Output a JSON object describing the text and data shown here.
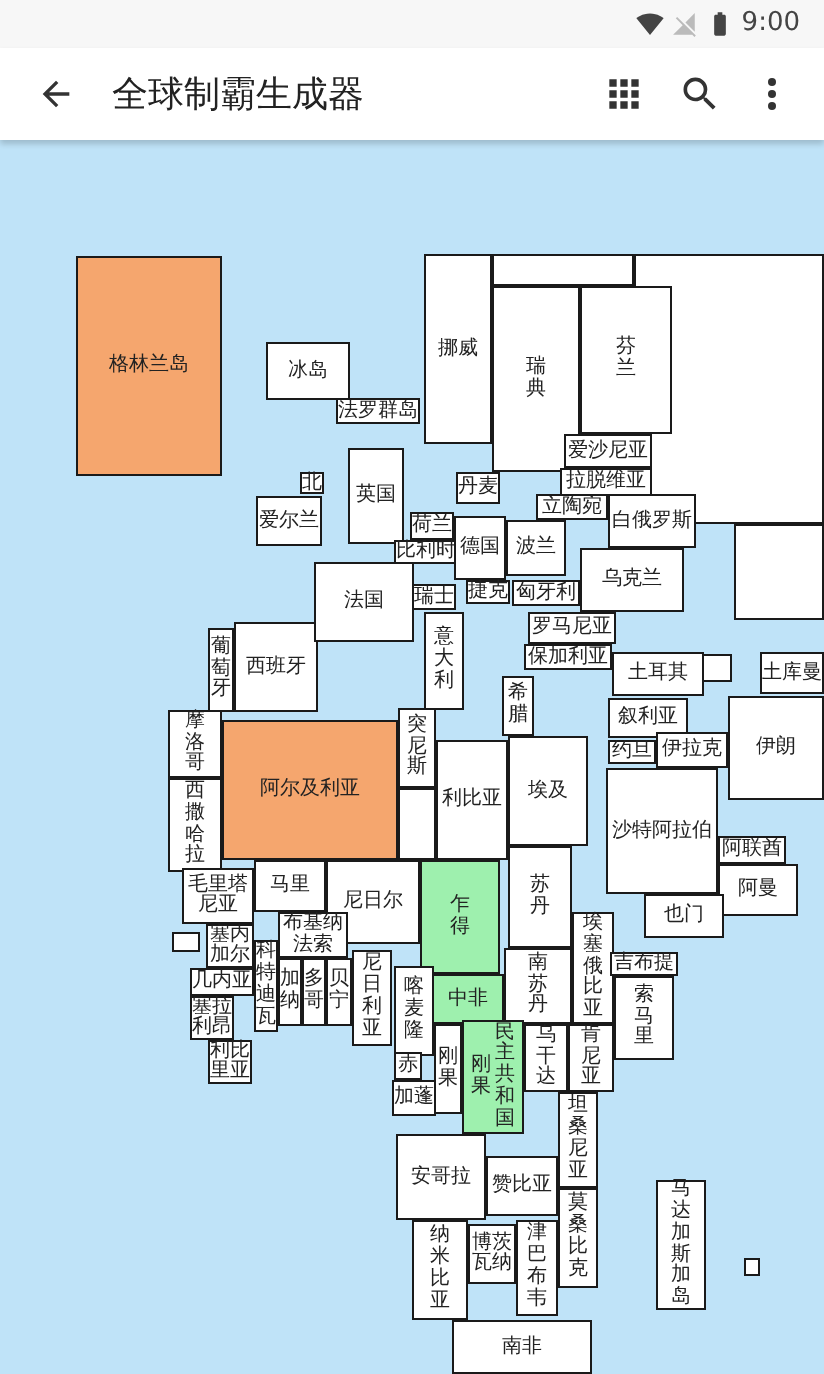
{
  "status_bar": {
    "time": "9:00"
  },
  "app_bar": {
    "title": "全球制霸生成器"
  },
  "countries": [
    {
      "name": "格林兰岛",
      "color": "#f5a66e"
    },
    {
      "name": "冰岛",
      "color": "#ffffff"
    },
    {
      "name": "法罗群岛",
      "color": "#ffffff"
    },
    {
      "name": "挪威",
      "color": "#ffffff"
    },
    {
      "name": "瑞典",
      "color": "#ffffff"
    },
    {
      "name": "芬兰",
      "color": "#ffffff"
    },
    {
      "name": "爱沙尼亚",
      "color": "#ffffff"
    },
    {
      "name": "丹麦",
      "color": "#ffffff"
    },
    {
      "name": "拉脱维亚",
      "color": "#ffffff"
    },
    {
      "name": "英国",
      "color": "#ffffff"
    },
    {
      "name": "北",
      "color": "#ffffff"
    },
    {
      "name": "爱尔兰",
      "color": "#ffffff"
    },
    {
      "name": "荷兰",
      "color": "#ffffff"
    },
    {
      "name": "比利时",
      "color": "#ffffff"
    },
    {
      "name": "立陶宛",
      "color": "#ffffff"
    },
    {
      "name": "白俄罗斯",
      "color": "#ffffff"
    },
    {
      "name": "德国",
      "color": "#ffffff"
    },
    {
      "name": "波兰",
      "color": "#ffffff"
    },
    {
      "name": "葡萄牙",
      "color": "#ffffff"
    },
    {
      "name": "西班牙",
      "color": "#ffffff"
    },
    {
      "name": "法国",
      "color": "#ffffff"
    },
    {
      "name": "瑞士",
      "color": "#ffffff"
    },
    {
      "name": "捷克",
      "color": "#ffffff"
    },
    {
      "name": "匈牙利",
      "color": "#ffffff"
    },
    {
      "name": "乌克兰",
      "color": "#ffffff"
    },
    {
      "name": "意大利",
      "color": "#ffffff"
    },
    {
      "name": "罗马尼亚",
      "color": "#ffffff"
    },
    {
      "name": "保加利亚",
      "color": "#ffffff"
    },
    {
      "name": "希腊",
      "color": "#ffffff"
    },
    {
      "name": "土耳其",
      "color": "#ffffff"
    },
    {
      "name": "叙利亚",
      "color": "#ffffff"
    },
    {
      "name": "伊朗",
      "color": "#ffffff"
    },
    {
      "name": "土库曼",
      "color": "#ffffff"
    },
    {
      "name": "摩洛哥",
      "color": "#ffffff"
    },
    {
      "name": "阿尔及利亚",
      "color": "#f5a66e"
    },
    {
      "name": "突尼斯",
      "color": "#ffffff"
    },
    {
      "name": "利比亚",
      "color": "#ffffff"
    },
    {
      "name": "埃及",
      "color": "#ffffff"
    },
    {
      "name": "约旦",
      "color": "#ffffff"
    },
    {
      "name": "伊拉克",
      "color": "#ffffff"
    },
    {
      "name": "西撒哈拉",
      "color": "#ffffff"
    },
    {
      "name": "毛里塔尼亚",
      "color": "#ffffff"
    },
    {
      "name": "马里",
      "color": "#ffffff"
    },
    {
      "name": "尼日尔",
      "color": "#ffffff"
    },
    {
      "name": "乍得",
      "color": "#9ef0ae"
    },
    {
      "name": "苏丹",
      "color": "#ffffff"
    },
    {
      "name": "沙特阿拉伯",
      "color": "#ffffff"
    },
    {
      "name": "阿联酋",
      "color": "#ffffff"
    },
    {
      "name": "阿曼",
      "color": "#ffffff"
    },
    {
      "name": "塞内加尔",
      "color": "#ffffff"
    },
    {
      "name": "几内亚",
      "color": "#ffffff"
    },
    {
      "name": "塞拉利昂",
      "color": "#ffffff"
    },
    {
      "name": "科特迪瓦",
      "color": "#ffffff"
    },
    {
      "name": "布基纳法索",
      "color": "#ffffff"
    },
    {
      "name": "加纳",
      "color": "#ffffff"
    },
    {
      "name": "多哥",
      "color": "#ffffff"
    },
    {
      "name": "贝宁",
      "color": "#ffffff"
    },
    {
      "name": "尼日利亚",
      "color": "#ffffff"
    },
    {
      "name": "喀麦隆",
      "color": "#ffffff"
    },
    {
      "name": "中非",
      "color": "#9ef0ae"
    },
    {
      "name": "南苏丹",
      "color": "#ffffff"
    },
    {
      "name": "埃塞俄比亚",
      "color": "#ffffff"
    },
    {
      "name": "吉布提",
      "color": "#ffffff"
    },
    {
      "name": "索马里",
      "color": "#ffffff"
    },
    {
      "name": "也门",
      "color": "#ffffff"
    },
    {
      "name": "利比里亚",
      "color": "#ffffff"
    },
    {
      "name": "赤",
      "color": "#ffffff"
    },
    {
      "name": "加蓬",
      "color": "#ffffff"
    },
    {
      "name": "刚果",
      "color": "#ffffff"
    },
    {
      "lines": [
        "刚果",
        "民主共和国"
      ],
      "color": "#9ef0ae"
    },
    {
      "name": "乌干达",
      "color": "#ffffff"
    },
    {
      "name": "肯尼亚",
      "color": "#ffffff"
    },
    {
      "name": "安哥拉",
      "color": "#ffffff"
    },
    {
      "name": "赞比亚",
      "color": "#ffffff"
    },
    {
      "name": "坦桑尼亚",
      "color": "#ffffff"
    },
    {
      "name": "纳米比亚",
      "color": "#ffffff"
    },
    {
      "name": "博茨瓦纳",
      "color": "#ffffff"
    },
    {
      "name": "津巴布韦",
      "color": "#ffffff"
    },
    {
      "name": "莫桑比克",
      "color": "#ffffff"
    },
    {
      "name": "马达加斯加岛",
      "color": "#ffffff"
    },
    {
      "name": "南非",
      "color": "#ffffff"
    }
  ]
}
